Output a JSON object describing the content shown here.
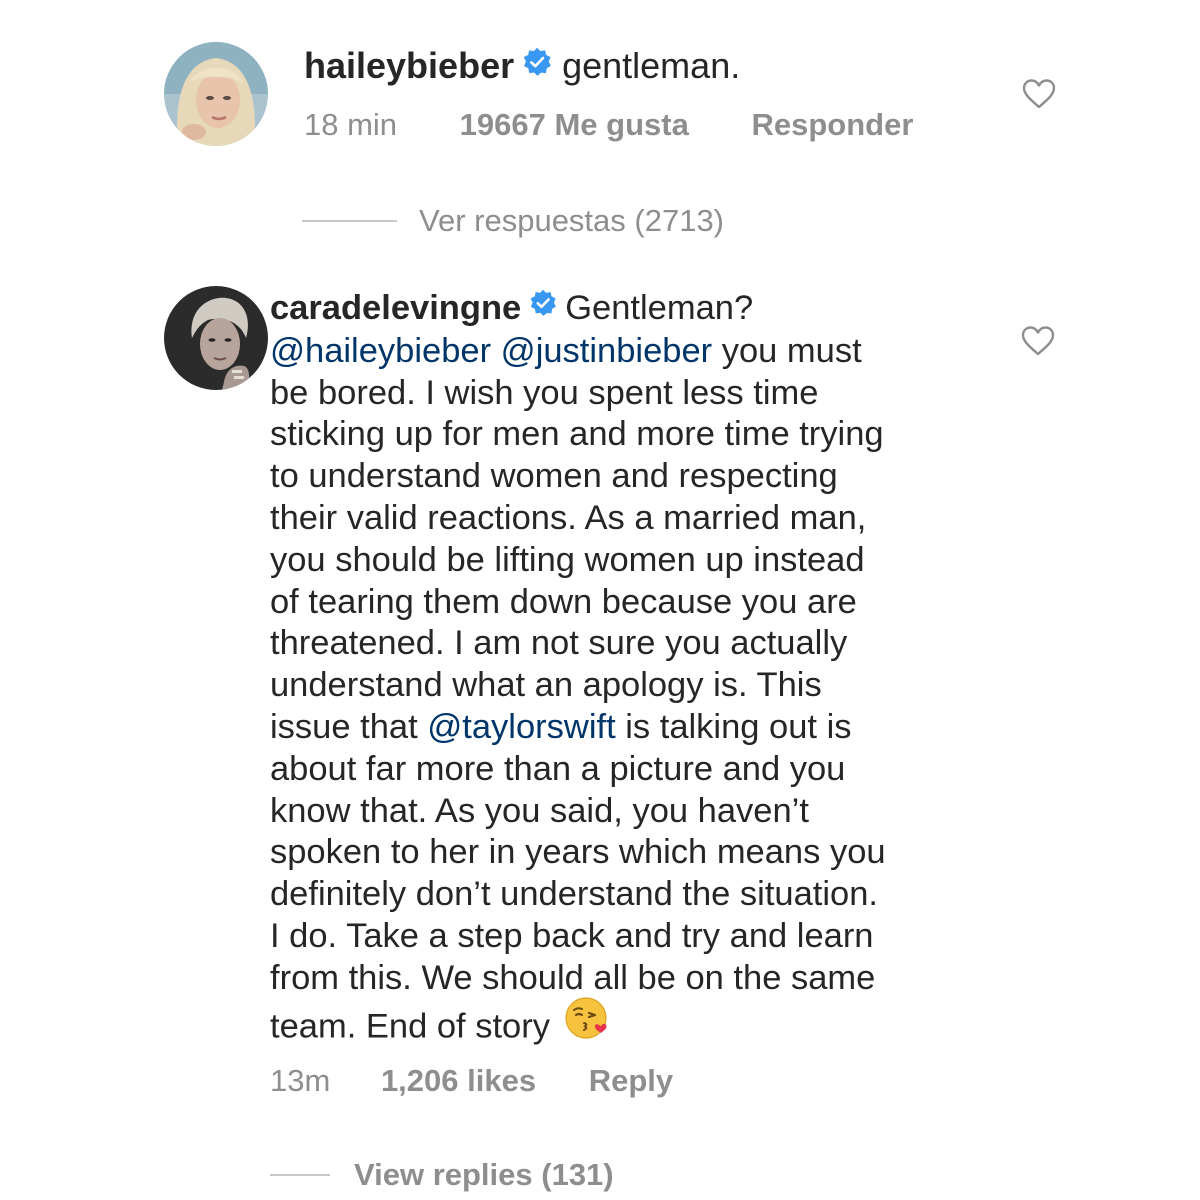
{
  "comments": [
    {
      "username": "haileybieber",
      "verified": true,
      "text": "gentleman.",
      "time": "18 min",
      "likes": "19667 Me gusta",
      "reply_label": "Responder",
      "view_replies": "Ver respuestas (2713)",
      "like_icon": "heart-outline-icon"
    },
    {
      "username": "caradelevingne",
      "verified": true,
      "lines": [
        {
          "segments": [
            {
              "text": "Gentleman?",
              "type": "text"
            }
          ]
        },
        {
          "segments": [
            {
              "text": "@haileybieber",
              "type": "mention"
            },
            {
              "text": " ",
              "type": "text"
            },
            {
              "text": "@justinbieber",
              "type": "mention"
            },
            {
              "text": " you must",
              "type": "text"
            }
          ]
        },
        {
          "segments": [
            {
              "text": "be bored. I wish you spent less time",
              "type": "text"
            }
          ]
        },
        {
          "segments": [
            {
              "text": "sticking up for men and more time trying",
              "type": "text"
            }
          ]
        },
        {
          "segments": [
            {
              "text": "to understand women and respecting",
              "type": "text"
            }
          ]
        },
        {
          "segments": [
            {
              "text": "their valid reactions. As a married man,",
              "type": "text"
            }
          ]
        },
        {
          "segments": [
            {
              "text": "you should be lifting women up instead",
              "type": "text"
            }
          ]
        },
        {
          "segments": [
            {
              "text": "of tearing them down because you are",
              "type": "text"
            }
          ]
        },
        {
          "segments": [
            {
              "text": "threatened. I am not sure you actually",
              "type": "text"
            }
          ]
        },
        {
          "segments": [
            {
              "text": "understand what an apology is. This",
              "type": "text"
            }
          ]
        },
        {
          "segments": [
            {
              "text": "issue that ",
              "type": "text"
            },
            {
              "text": "@taylorswift",
              "type": "mention"
            },
            {
              "text": " is talking out is",
              "type": "text"
            }
          ]
        },
        {
          "segments": [
            {
              "text": "about far more than a picture and you",
              "type": "text"
            }
          ]
        },
        {
          "segments": [
            {
              "text": "know that. As you said, you haven’t",
              "type": "text"
            }
          ]
        },
        {
          "segments": [
            {
              "text": "spoken to her in years which means you",
              "type": "text"
            }
          ]
        },
        {
          "segments": [
            {
              "text": "definitely don’t understand the situation.",
              "type": "text"
            }
          ]
        },
        {
          "segments": [
            {
              "text": "I do. Take a step back and try and learn",
              "type": "text"
            }
          ]
        },
        {
          "segments": [
            {
              "text": "from this. We should all be on the same",
              "type": "text"
            }
          ]
        },
        {
          "segments": [
            {
              "text": "team. End of story",
              "type": "text"
            }
          ]
        }
      ],
      "end_emoji": "face-blowing-a-kiss-emoji",
      "time": "13m",
      "likes": "1,206 likes",
      "reply_label": "Reply",
      "view_replies": "View replies (131)",
      "like_icon": "heart-outline-icon"
    }
  ],
  "colors": {
    "text": "#262626",
    "secondary": "#8e8e8e",
    "mention": "#003569",
    "verified": "#3897f0"
  }
}
